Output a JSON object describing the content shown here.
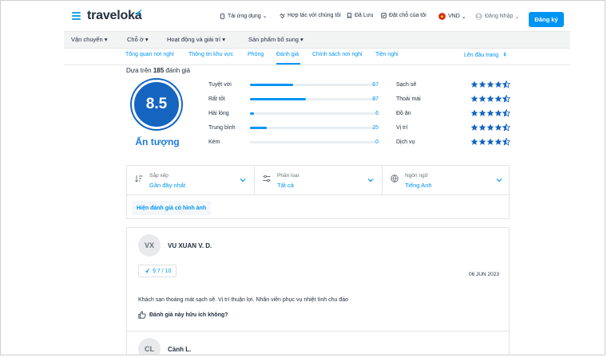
{
  "header": {
    "logo": "traveloka",
    "nav": [
      {
        "label": "Tải ứng dụng",
        "icon": "phone-icon"
      },
      {
        "label": "Hợp tác với chúng tôi",
        "icon": "handshake-icon"
      },
      {
        "label": "Đã Lưu",
        "icon": "bookmark-icon"
      },
      {
        "label": "Đặt chỗ của tôi",
        "icon": "booking-icon"
      },
      {
        "label": "VND",
        "icon": "flag-icon"
      },
      {
        "label": "Đăng Nhập",
        "icon": "user-icon"
      }
    ],
    "register_label": "Đăng ký"
  },
  "categories": [
    "Vận chuyển",
    "Chỗ ở",
    "Hoạt động và giải trí",
    "Sản phẩm bổ sung"
  ],
  "subtabs": [
    "Tổng quan nơi nghỉ",
    "Thông tin khu vực",
    "Phòng",
    "Đánh giá",
    "Chính sách nơi nghỉ",
    "Tiện nghi"
  ],
  "back_to_top": "Lên đầu trang",
  "summary": {
    "based_prefix": "Dựa trên",
    "based_count": "185",
    "based_suffix": "đánh giá",
    "score": "8.5",
    "score_label": "Ấn tượng",
    "ratings": [
      {
        "label": "Tuyệt vời",
        "count": "67",
        "fraction": 0.34
      },
      {
        "label": "Rất tốt",
        "count": "87",
        "fraction": 0.44
      },
      {
        "label": "Hài lòng",
        "count": "6",
        "fraction": 0.03
      },
      {
        "label": "Trung bình",
        "count": "25",
        "fraction": 0.13
      },
      {
        "label": "Kém",
        "count": "0",
        "fraction": 0.0
      }
    ],
    "categories": [
      {
        "label": "Sạch sẽ",
        "stars": 4.5
      },
      {
        "label": "Thoải mái",
        "stars": 4.5
      },
      {
        "label": "Đồ ăn",
        "stars": 4.5
      },
      {
        "label": "Vị trí",
        "stars": 4.5
      },
      {
        "label": "Dịch vụ",
        "stars": 4.5
      }
    ]
  },
  "filters": {
    "sort": {
      "label": "Sắp xếp",
      "value": "Gần đây nhất"
    },
    "classify": {
      "label": "Phân loại",
      "value": "Tất cả"
    },
    "language": {
      "label": "Ngôn ngữ",
      "value": "Tiếng Anh"
    },
    "photo_chip": "Hiện đánh giá có hình ảnh"
  },
  "reviews": [
    {
      "initials": "VX",
      "name": "VU XUAN V. D.",
      "score": "9.7 / 10",
      "date": "06 JUN 2023",
      "text": "Khách sạn thoáng mát sạch sẽ. Vị trí thuận lợi. Nhân viên phục vụ nhiệt tình chu đáo",
      "helpful": "Đánh giá này hữu ích không?"
    },
    {
      "initials": "CL",
      "name": "Cảnh L."
    }
  ],
  "colors": {
    "brand": "#0194f3",
    "score_circle": "#1565c0",
    "star": "#1565c0"
  }
}
